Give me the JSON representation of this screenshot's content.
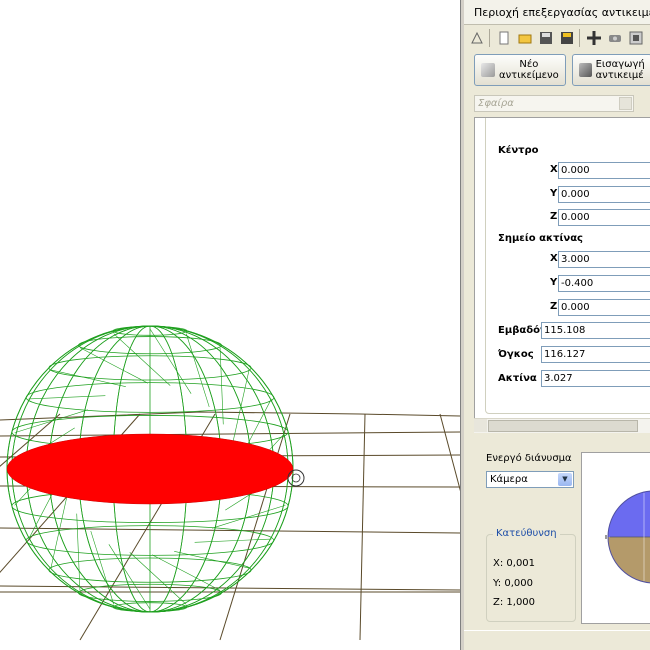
{
  "window": {
    "title": "Περιοχή επεξεργασίας αντικειμένων"
  },
  "toolbar": {
    "icons": [
      "graph-icon",
      "new-file-icon",
      "open-folder-icon",
      "save-icon",
      "save-as-icon",
      "move-icon",
      "camera-icon",
      "display-icon"
    ]
  },
  "buttons": {
    "new_object_line1": "Νέο",
    "new_object_line2": "αντικείμενο",
    "import_line1": "Εισαγωγή",
    "import_line2": "αντικειμέ"
  },
  "object_select": {
    "value": "Σφαίρα"
  },
  "properties": {
    "center_label": "Κέντρο",
    "center": {
      "x_label": "X",
      "x": "0.000",
      "y_label": "Y",
      "y": "0.000",
      "z_label": "Z",
      "z": "0.000"
    },
    "radius_point_label": "Σημείο ακτίνας",
    "radius_point": {
      "x_label": "X",
      "x": "3.000",
      "y_label": "Y",
      "y": "-0.400",
      "z_label": "Z",
      "z": "0.000"
    },
    "area_label": "Εμβαδόν",
    "area": "115.108",
    "volume_label": "Όγκος",
    "volume": "116.127",
    "radius_label": "Ακτίνα",
    "radius": "3.027"
  },
  "active_vector": {
    "label": "Ενεργό διάνυσμα",
    "value": "Κάμερα"
  },
  "direction": {
    "title": "Κατεύθυνση",
    "x": "X: 0,001",
    "y": "Y: 0,000",
    "z": "Z: 1,000"
  },
  "colors": {
    "sphere_wire": "#1fa01f",
    "disc": "#ff0000",
    "grid": "#5a4a2a",
    "gizmo_top": "#6b6bf0",
    "gizmo_bottom": "#b49a6a"
  }
}
